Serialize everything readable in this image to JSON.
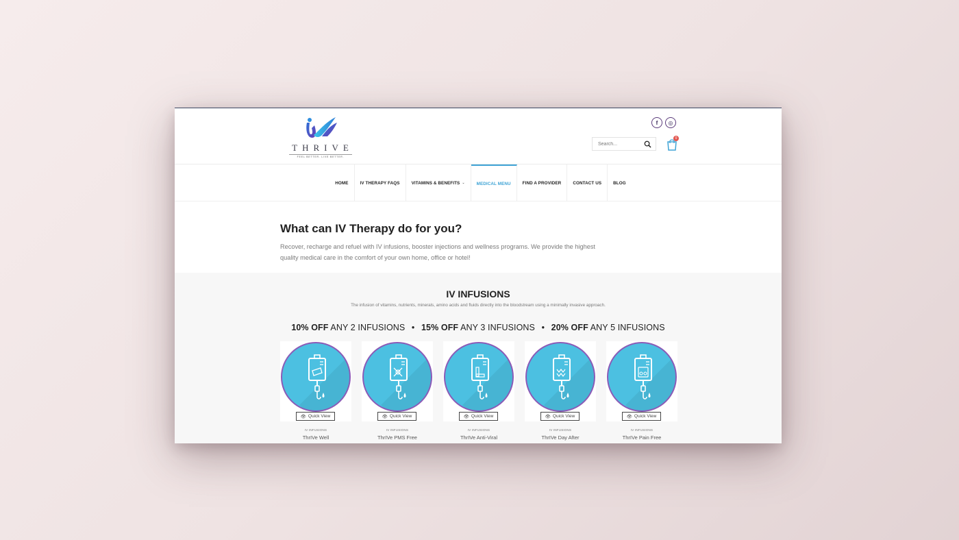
{
  "header": {
    "logo_word": "THRIVE",
    "logo_tagline": "FEEL BETTER. LIVE BETTER.",
    "social": [
      {
        "icon": "facebook-icon",
        "glyph": "f"
      },
      {
        "icon": "instagram-icon",
        "glyph": "◎"
      }
    ],
    "search_placeholder": "Search...",
    "cart_count": "0"
  },
  "nav": {
    "items": [
      {
        "label": "HOME"
      },
      {
        "label": "IV THERAPY FAQS"
      },
      {
        "label": "VITAMINS & BENEFITS"
      },
      {
        "label": "MEDICAL MENU"
      },
      {
        "label": "FIND A PROVIDER"
      },
      {
        "label": "CONTACT US"
      },
      {
        "label": "BLOG"
      }
    ],
    "active": "MEDICAL MENU"
  },
  "intro": {
    "title": "What can IV Therapy do for you?",
    "text": "Recover, recharge and refuel with IV infusions, booster injections and wellness programs. We provide the highest quality medical care in the comfort of your own home, office or hotel!"
  },
  "infusions": {
    "title": "IV INFUSIONS",
    "description": "The infusion of vitamins, nutrients, minerals, amino acids and fluids directly into the bloodstream using a minimally invasive approach.",
    "offers": [
      {
        "pct": "10% OFF",
        "rest": "ANY 2 INFUSIONS"
      },
      {
        "pct": "15% OFF",
        "rest": "ANY 3 INFUSIONS"
      },
      {
        "pct": "20% OFF",
        "rest": "ANY 5 INFUSIONS"
      }
    ],
    "quick_view_label": "Quick View",
    "products": [
      {
        "category": "IV INFUSIONS",
        "name": "ThrIVe Well"
      },
      {
        "category": "IV INFUSIONS",
        "name": "ThrIVe PMS Free"
      },
      {
        "category": "IV INFUSIONS",
        "name": "ThrIVe Anti-Viral"
      },
      {
        "category": "IV INFUSIONS",
        "name": "ThrIVe Day After"
      },
      {
        "category": "IV INFUSIONS",
        "name": "ThrIVe Pain Free"
      }
    ]
  },
  "colors": {
    "accent": "#3ea3d5",
    "circle": "#4cc0e1",
    "circle_border": "#8b5bb7",
    "badge": "#e2564f"
  }
}
